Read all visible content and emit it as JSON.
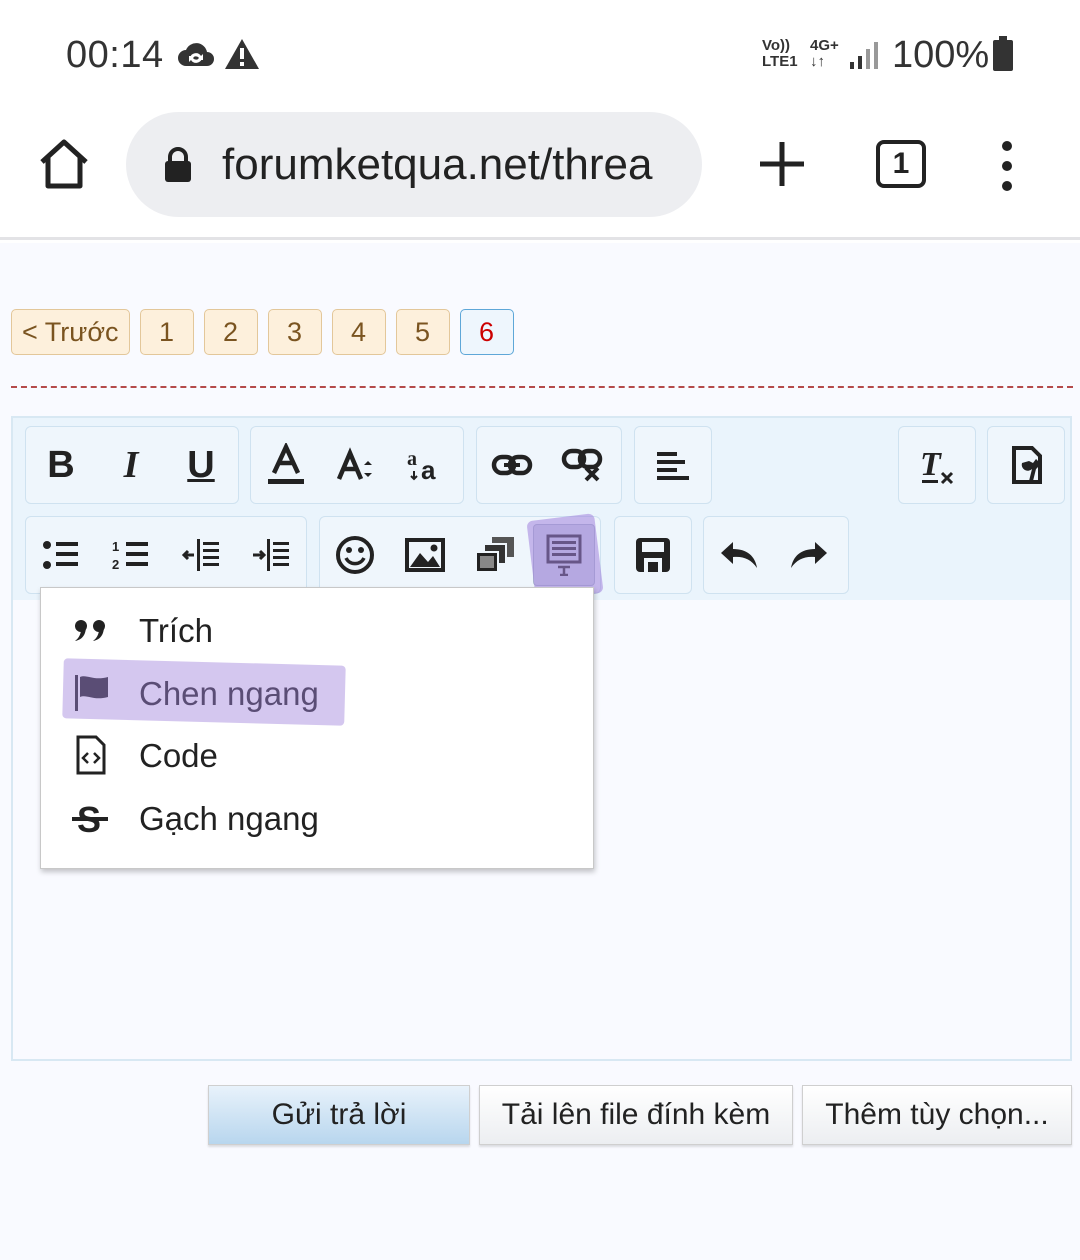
{
  "status_bar": {
    "time": "00:14",
    "net_top": "Vo))",
    "net_bottom": "LTE1",
    "net_type": "4G+",
    "battery": "100%",
    "icons": [
      "cloud-sync-icon",
      "warning-icon",
      "signal-icon",
      "battery-icon"
    ]
  },
  "browser": {
    "url": "forumketqua.net/threa",
    "tab_count": "1",
    "icons": [
      "home-icon",
      "lock-icon",
      "plus-icon",
      "more-vert-icon"
    ]
  },
  "pager": {
    "prev_label": "< Trước",
    "pages": [
      "1",
      "2",
      "3",
      "4",
      "5",
      "6"
    ],
    "current": "6"
  },
  "toolbar": {
    "row1": [
      "bold",
      "italic",
      "underline",
      "font-color",
      "font-size",
      "font-family",
      "link",
      "unlink",
      "align",
      "remove-format",
      "toggle-source"
    ],
    "row2": [
      "bullet-list",
      "numbered-list",
      "outdent",
      "indent",
      "smilies",
      "image",
      "media",
      "insert-more",
      "save",
      "undo",
      "redo"
    ],
    "labels": {
      "bold": "B",
      "italic": "I",
      "underline": "U",
      "font_color": "A"
    }
  },
  "dropdown": {
    "items": [
      {
        "label": "Trích",
        "icon": "quote-icon"
      },
      {
        "label": "Chen ngang",
        "icon": "flag-icon"
      },
      {
        "label": "Code",
        "icon": "code-file-icon"
      },
      {
        "label": "Gạch ngang",
        "icon": "strikethrough-icon"
      }
    ]
  },
  "actions": {
    "reply": "Gửi trả lời",
    "upload": "Tải lên file đính kèm",
    "more": "Thêm tùy chọn..."
  },
  "colors": {
    "accent_highlight": "#a082dc",
    "pager_bg": "#fdf0dc",
    "pager_current_border": "#5ea7d8",
    "primary_button": "#b8d6ee"
  }
}
